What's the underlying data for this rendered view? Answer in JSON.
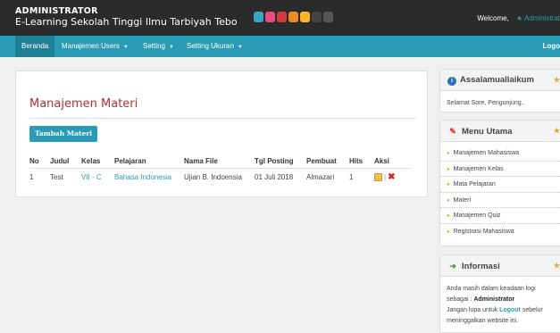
{
  "header": {
    "role": "ADMINISTRATOR",
    "site_title": "E-Learning Sekolah Tinggi Ilmu Tarbiyah Tebo",
    "welcome_label": "Welcome,",
    "user_name": "Administrat",
    "swatch_colors": [
      "#3aa6c6",
      "#e84d7f",
      "#d23b3b",
      "#f08a24",
      "#ffb42a",
      "#444444",
      "#555555"
    ]
  },
  "nav": {
    "items": [
      {
        "label": "Beranda",
        "active": true
      },
      {
        "label": "Manajemen Users",
        "dropdown": true
      },
      {
        "label": "Setting",
        "dropdown": true
      },
      {
        "label": "Setting Ukuran",
        "dropdown": true
      }
    ],
    "logout": "Logo"
  },
  "main": {
    "title": "Manajemen Materi",
    "add_button": "Tambah Materi",
    "columns": [
      "No",
      "Judul",
      "Kelas",
      "Pelajaran",
      "Nama File",
      "Tgl Posting",
      "Pembuat",
      "Hits",
      "Aksi"
    ],
    "rows": [
      {
        "no": "1",
        "judul": "Test",
        "kelas": "VII - C",
        "pelajaran": "Bahasa Indonesia",
        "file": "Ujian B. Indoensia",
        "tgl": "01 Juli 2018",
        "pembuat": "Almazari",
        "hits": "1"
      }
    ]
  },
  "sidebar": {
    "greeting": {
      "title": "Assalamuallaikum",
      "text": "Selamat Sore, Pengunjung.."
    },
    "menu": {
      "title": "Menu Utama",
      "items": [
        "Manajemen Mahasiswa",
        "Manajemen Kelas",
        "Mata Pelajaran",
        "Materi",
        "Manajemen Quiz",
        "Registrasi Mahasiswa"
      ]
    },
    "info": {
      "title": "Informasi",
      "t1": "Anda masih dalam keadaan logi",
      "t2": "sebagai :",
      "role": "Administrator",
      "t3": "Jangan lupa untuk",
      "logout": "Logout",
      "t4": "sebelur",
      "t5": "meninggalkan website ini."
    }
  }
}
